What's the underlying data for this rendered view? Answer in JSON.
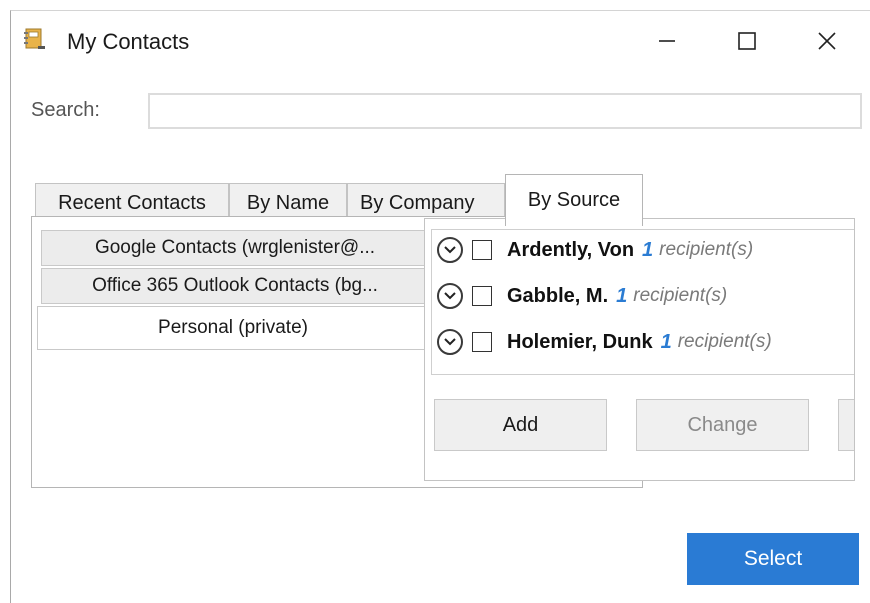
{
  "window": {
    "title": "My Contacts",
    "icon": "contacts-book-icon",
    "controls": {
      "minimize": "minimize-icon",
      "maximize": "maximize-icon",
      "close": "close-icon"
    }
  },
  "search": {
    "label": "Search:",
    "value": ""
  },
  "tabs": [
    {
      "label": "Recent Contacts",
      "active": false
    },
    {
      "label": "By Name",
      "active": false
    },
    {
      "label": "By Company",
      "active": false
    },
    {
      "label": "By Source",
      "active": true
    }
  ],
  "sources": [
    {
      "label": "Google Contacts (wrglenister@...",
      "selected": false
    },
    {
      "label": "Office 365 Outlook Contacts (bg...",
      "selected": false
    },
    {
      "label": "Personal (private)",
      "selected": true
    }
  ],
  "contacts": [
    {
      "name": "Ardently, Von",
      "count": "1",
      "suffix": "recipient(s)",
      "checked": false
    },
    {
      "name": "Gabble, M.",
      "count": "1",
      "suffix": "recipient(s)",
      "checked": false
    },
    {
      "name": "Holemier, Dunk",
      "count": "1",
      "suffix": "recipient(s)",
      "checked": false
    }
  ],
  "actions": {
    "add": "Add",
    "change": "Change"
  },
  "footer": {
    "select": "Select"
  },
  "colors": {
    "accent": "#2a7bd4",
    "count_blue": "#2b7cd3",
    "muted_text": "#7a7a7a"
  }
}
